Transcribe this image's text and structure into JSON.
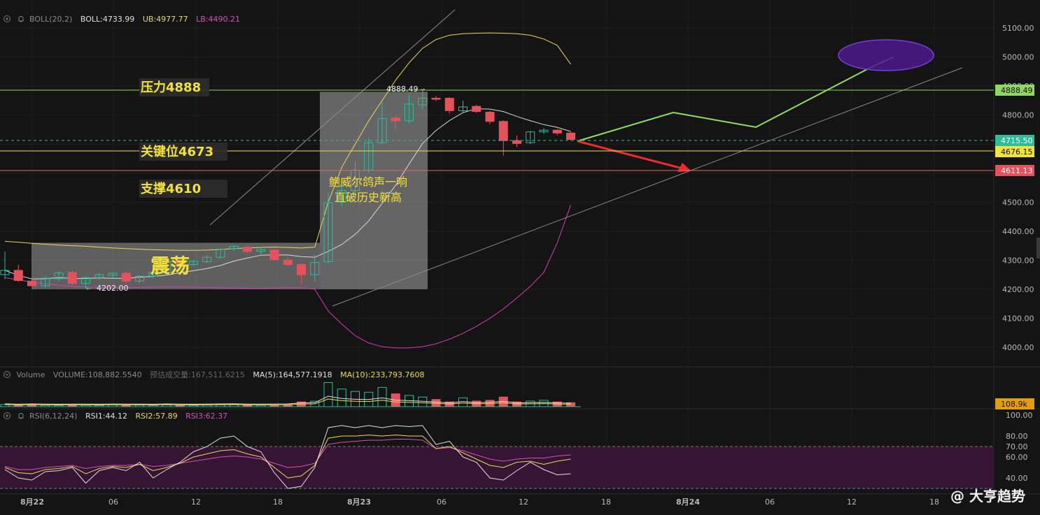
{
  "boll_header": {
    "name": "BOLL(20,2)",
    "boll": "BOLL:4733.99",
    "ub": "UB:4977.77",
    "lb": "LB:4490.21"
  },
  "volume_header": {
    "name": "Volume",
    "volume": "VOLUME:108,882.5540",
    "est": "预估成交量:167,511.6215",
    "ma5": "MA(5):164,577.1918",
    "ma10": "MA(10):233,793.7608"
  },
  "rsi_header": {
    "name": "RSI(6,12,24)",
    "rsi1": "RSI1:44.12",
    "rsi2": "RSI2:57.89",
    "rsi3": "RSI3:62.37"
  },
  "annotations": {
    "resistance": "压力4888",
    "key_level": "关键位4673",
    "support": "支撑4610",
    "consolidation": "震荡",
    "news_line1": "鲍威尔鸽声一响",
    "news_line2": "直破历史新高",
    "high_marker": "4888.49",
    "low_marker": "4202.00"
  },
  "price_tags": {
    "resistance": "4888.49",
    "current": "4715.50",
    "key": "4676.15",
    "support": "4611.13",
    "volume": "108.9k"
  },
  "watermark": "@ 大亨趋势",
  "colors": {
    "up": "#2dbd9a",
    "down": "#e5525e",
    "mid_band": "#d8d8d8",
    "upper_band": "#e6d85a",
    "lower_band": "#d63ab5",
    "resistance_line": "#8fd862",
    "key_line": "#e9e04a",
    "support_line": "#ef5d6b",
    "projection": "#8fe05c",
    "arrow": "#ee2a2a",
    "ellipse": "#4a1a8c",
    "rsi_zone": "#3a1436"
  },
  "chart_data": {
    "type": "candlestick",
    "x_ticks": [
      "8月22",
      "06",
      "12",
      "18",
      "8月23",
      "06",
      "12",
      "18",
      "8月24",
      "06",
      "12",
      "18"
    ],
    "y_ticks": [
      5100,
      5000,
      4900,
      4800,
      4700,
      4600,
      4500,
      4400,
      4300,
      4200,
      4100,
      4000
    ],
    "ylim": [
      3950,
      5150
    ],
    "candles": [
      {
        "o": 4250,
        "h": 4330,
        "l": 4235,
        "c": 4265
      },
      {
        "o": 4265,
        "h": 4285,
        "l": 4225,
        "c": 4230
      },
      {
        "o": 4228,
        "h": 4240,
        "l": 4210,
        "c": 4212
      },
      {
        "o": 4212,
        "h": 4245,
        "l": 4205,
        "c": 4238
      },
      {
        "o": 4236,
        "h": 4262,
        "l": 4228,
        "c": 4256
      },
      {
        "o": 4258,
        "h": 4264,
        "l": 4212,
        "c": 4220
      },
      {
        "o": 4220,
        "h": 4245,
        "l": 4202,
        "c": 4240
      },
      {
        "o": 4240,
        "h": 4256,
        "l": 4232,
        "c": 4250
      },
      {
        "o": 4248,
        "h": 4258,
        "l": 4238,
        "c": 4255
      },
      {
        "o": 4255,
        "h": 4262,
        "l": 4220,
        "c": 4228
      },
      {
        "o": 4228,
        "h": 4248,
        "l": 4222,
        "c": 4245
      },
      {
        "o": 4245,
        "h": 4262,
        "l": 4238,
        "c": 4258
      },
      {
        "o": 4258,
        "h": 4300,
        "l": 4252,
        "c": 4295
      },
      {
        "o": 4292,
        "h": 4298,
        "l": 4280,
        "c": 4285
      },
      {
        "o": 4285,
        "h": 4300,
        "l": 4280,
        "c": 4296
      },
      {
        "o": 4295,
        "h": 4318,
        "l": 4290,
        "c": 4310
      },
      {
        "o": 4310,
        "h": 4340,
        "l": 4305,
        "c": 4338
      },
      {
        "o": 4340,
        "h": 4352,
        "l": 4332,
        "c": 4348
      },
      {
        "o": 4345,
        "h": 4350,
        "l": 4325,
        "c": 4330
      },
      {
        "o": 4330,
        "h": 4345,
        "l": 4320,
        "c": 4336
      },
      {
        "o": 4335,
        "h": 4338,
        "l": 4298,
        "c": 4302
      },
      {
        "o": 4300,
        "h": 4310,
        "l": 4280,
        "c": 4285
      },
      {
        "o": 4285,
        "h": 4290,
        "l": 4220,
        "c": 4250
      },
      {
        "o": 4250,
        "h": 4320,
        "l": 4225,
        "c": 4292
      },
      {
        "o": 4295,
        "h": 4530,
        "l": 4290,
        "c": 4498
      },
      {
        "o": 4500,
        "h": 4560,
        "l": 4485,
        "c": 4540
      },
      {
        "o": 4540,
        "h": 4640,
        "l": 4530,
        "c": 4610
      },
      {
        "o": 4610,
        "h": 4720,
        "l": 4600,
        "c": 4705
      },
      {
        "o": 4705,
        "h": 4845,
        "l": 4700,
        "c": 4788
      },
      {
        "o": 4790,
        "h": 4800,
        "l": 4750,
        "c": 4780
      },
      {
        "o": 4780,
        "h": 4870,
        "l": 4770,
        "c": 4838
      },
      {
        "o": 4835,
        "h": 4888,
        "l": 4820,
        "c": 4858
      },
      {
        "o": 4858,
        "h": 4866,
        "l": 4848,
        "c": 4855
      },
      {
        "o": 4858,
        "h": 4862,
        "l": 4805,
        "c": 4815
      },
      {
        "o": 4815,
        "h": 4850,
        "l": 4810,
        "c": 4828
      },
      {
        "o": 4830,
        "h": 4835,
        "l": 4808,
        "c": 4812
      },
      {
        "o": 4810,
        "h": 4815,
        "l": 4768,
        "c": 4778
      },
      {
        "o": 4778,
        "h": 4782,
        "l": 4660,
        "c": 4712
      },
      {
        "o": 4712,
        "h": 4730,
        "l": 4690,
        "c": 4702
      },
      {
        "o": 4705,
        "h": 4745,
        "l": 4700,
        "c": 4742
      },
      {
        "o": 4742,
        "h": 4755,
        "l": 4735,
        "c": 4748
      },
      {
        "o": 4748,
        "h": 4752,
        "l": 4730,
        "c": 4738
      },
      {
        "o": 4738,
        "h": 4742,
        "l": 4712,
        "c": 4716
      }
    ],
    "volume": [
      14,
      8,
      12,
      9,
      8,
      10,
      9,
      8,
      11,
      9,
      10,
      8,
      12,
      9,
      8,
      10,
      12,
      14,
      10,
      9,
      11,
      12,
      30,
      34,
      150,
      110,
      95,
      90,
      120,
      80,
      70,
      60,
      45,
      30,
      55,
      35,
      40,
      60,
      30,
      35,
      40,
      30,
      25
    ],
    "rsi1": [
      48,
      40,
      38,
      46,
      47,
      50,
      35,
      47,
      50,
      47,
      55,
      40,
      48,
      55,
      65,
      70,
      78,
      80,
      70,
      65,
      45,
      30,
      32,
      50,
      88,
      90,
      88,
      90,
      88,
      90,
      89,
      90,
      72,
      75,
      60,
      55,
      40,
      38,
      47,
      55,
      48,
      43,
      44
    ],
    "rsi2": [
      50,
      45,
      44,
      48,
      49,
      51,
      44,
      49,
      51,
      50,
      53,
      47,
      50,
      54,
      60,
      63,
      66,
      67,
      63,
      60,
      50,
      40,
      42,
      52,
      78,
      80,
      80,
      81,
      80,
      81,
      80,
      80,
      68,
      70,
      64,
      58,
      52,
      50,
      55,
      56,
      53,
      56,
      58
    ],
    "rsi3": [
      51,
      48,
      48,
      50,
      51,
      52,
      49,
      51,
      52,
      52,
      53,
      51,
      52,
      54,
      56,
      58,
      60,
      61,
      60,
      58,
      54,
      50,
      51,
      54,
      72,
      74,
      75,
      76,
      76,
      77,
      77,
      76,
      68,
      69,
      66,
      62,
      58,
      56,
      58,
      59,
      59,
      61,
      62
    ]
  }
}
